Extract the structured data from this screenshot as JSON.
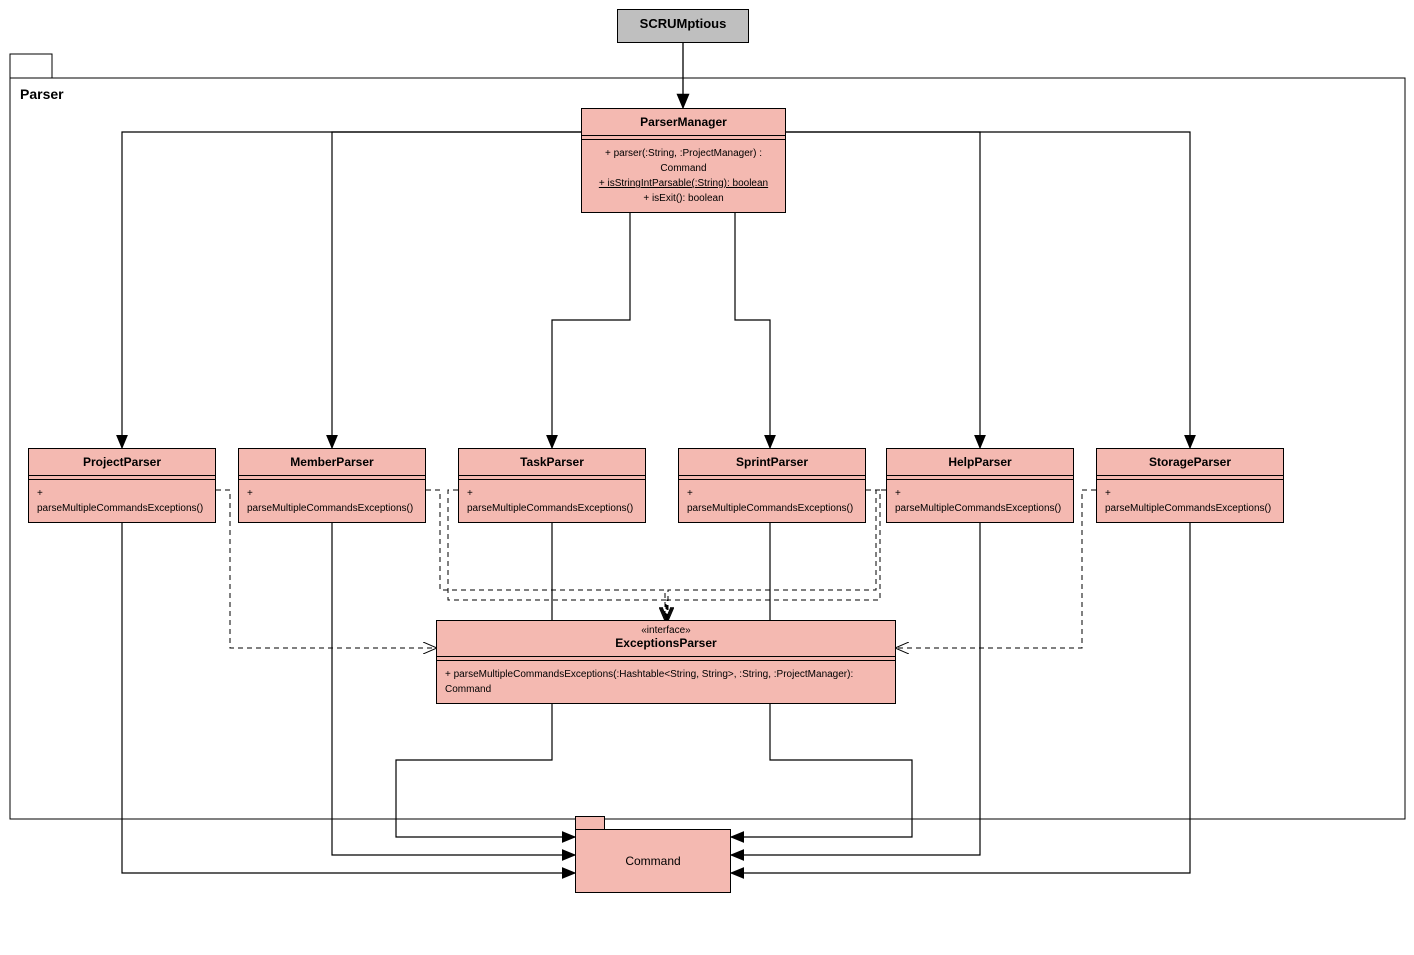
{
  "top_node": {
    "label": "SCRUMptious"
  },
  "package": {
    "label": "Parser"
  },
  "parser_manager": {
    "name": "ParserManager",
    "m1": "+ parser(:String, :ProjectManager) : Command",
    "m2": "+ isStringIntParsable(:String): boolean",
    "m3": "+ isExit(): boolean"
  },
  "parsers": {
    "project": {
      "name": "ProjectParser",
      "m1": "+ parseMultipleCommandsExceptions()"
    },
    "member": {
      "name": "MemberParser",
      "m1": "+ parseMultipleCommandsExceptions()"
    },
    "task": {
      "name": "TaskParser",
      "m1": "+ parseMultipleCommandsExceptions()"
    },
    "sprint": {
      "name": "SprintParser",
      "m1": "+ parseMultipleCommandsExceptions()"
    },
    "help": {
      "name": "HelpParser",
      "m1": "+ parseMultipleCommandsExceptions()"
    },
    "storage": {
      "name": "StorageParser",
      "m1": "+ parseMultipleCommandsExceptions()"
    }
  },
  "interface": {
    "stereo": "«interface»",
    "name": "ExceptionsParser",
    "m1": "+ parseMultipleCommandsExceptions(:Hashtable<String, String>, :String, :ProjectManager): Command"
  },
  "command": {
    "label": "Command"
  },
  "colors": {
    "pink": "#f4b9b1",
    "gray": "#bfbfbf"
  }
}
